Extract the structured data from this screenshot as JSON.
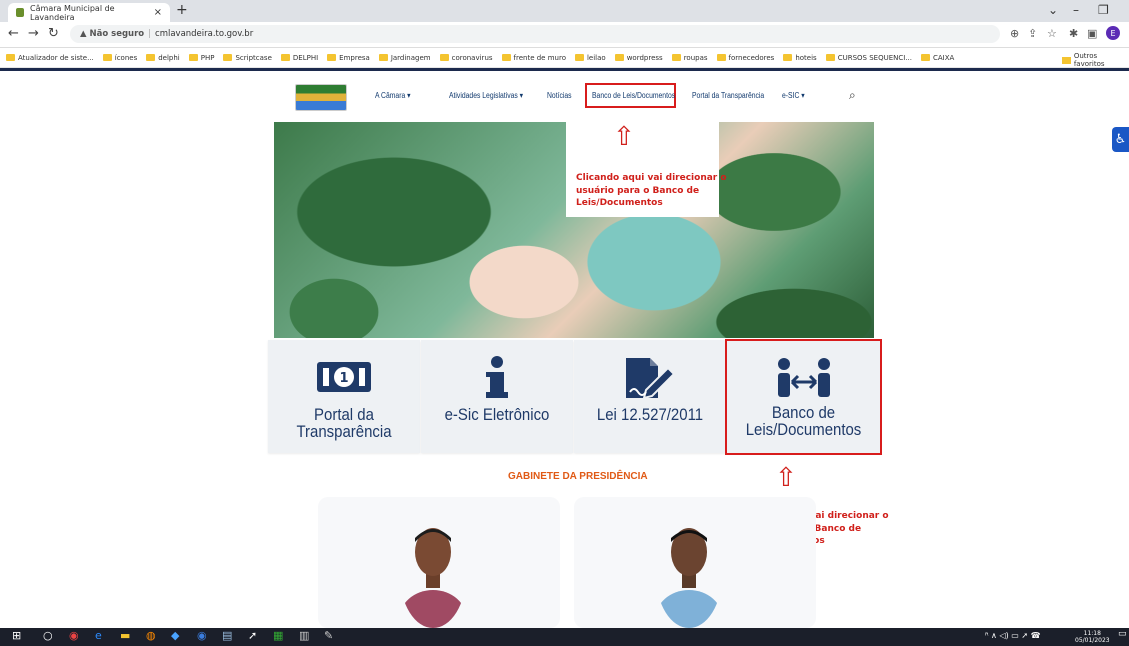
{
  "browser": {
    "tab_title": "Câmara Municipal de Lavandeira",
    "tab_close": "×",
    "new_tab": "+",
    "url_warning": "▲ Não seguro",
    "url_separator": "|",
    "url": "cmlavandeira.to.gov.br",
    "profile_initial": "E",
    "bookmarks": [
      "Atualizador de siste...",
      "ícones",
      "delphi",
      "PHP",
      "Scriptcase",
      "DELPHI",
      "Empresa",
      "Jardinagem",
      "coronavirus",
      "frente de muro",
      "leilao",
      "wordpress",
      "roupas",
      "fornecedores",
      "hoteis",
      "CURSOS SEQUENCI...",
      "CAIXA"
    ],
    "other_bookmarks": "Outros favoritos"
  },
  "site": {
    "nav": {
      "camara": "A Câmara ▾",
      "atividades": "Atividades Legislativas ▾",
      "noticias": "Notícias",
      "banco": "Banco de Leis/Documentos",
      "portal": "Portal da Transparência",
      "esic": "e-SIC ▾"
    },
    "cards": [
      {
        "label": "Portal da Transparência",
        "icon": "money-bill-icon"
      },
      {
        "label": "e-Sic Eletrônico",
        "icon": "info-icon"
      },
      {
        "label": "Lei 12.527/2011",
        "icon": "file-signature-icon"
      },
      {
        "label_line1": "Banco de",
        "label_line2": "Leis/Documentos",
        "icon": "people-exchange-icon"
      }
    ],
    "section_title": "GABINETE DA PRESIDÊNCIA"
  },
  "annotations": {
    "note1": [
      "Clicando aqui vai direcionar o",
      "usuário para o Banco de",
      "Leis/Documentos"
    ],
    "note2": [
      "Clicando aqui vai direcionar o",
      "usuário para o Banco de",
      "Leis/Documentos"
    ],
    "color": "#d0201b"
  },
  "taskbar": {
    "time": "11:18",
    "date": "05/01/2023"
  }
}
